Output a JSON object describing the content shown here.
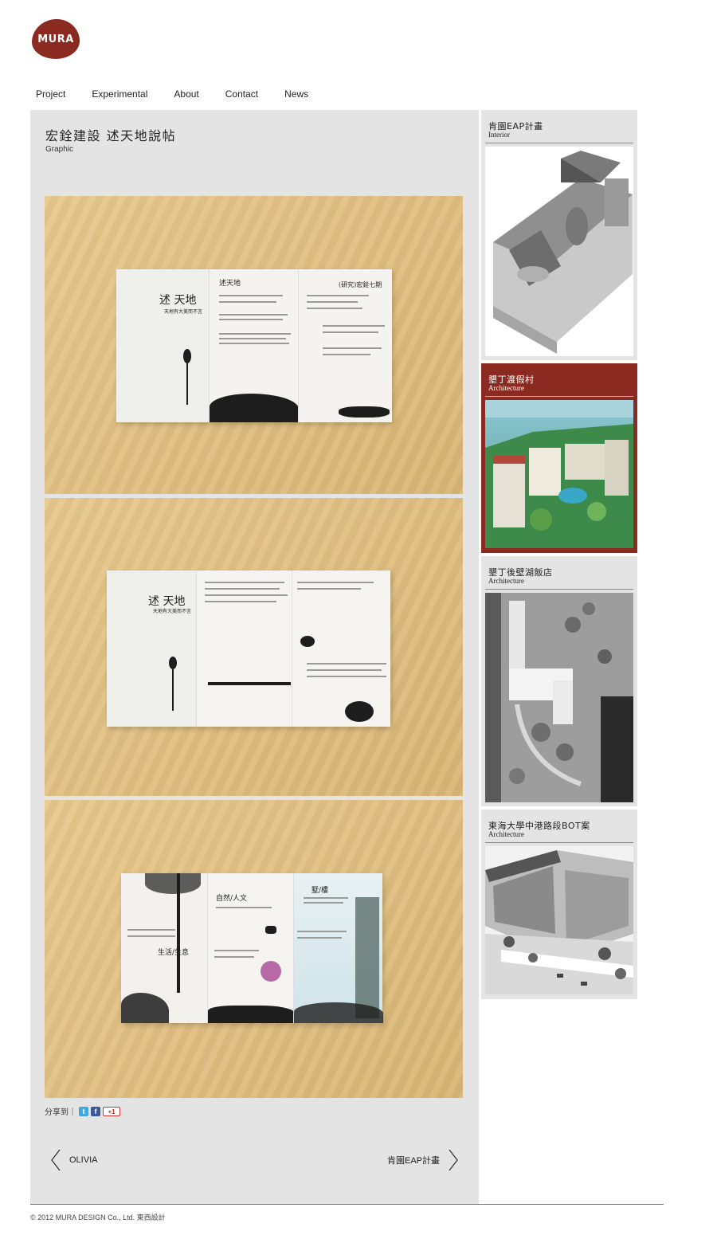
{
  "brand": {
    "logo_text": "MURA",
    "color": "#8a2a20"
  },
  "nav": {
    "items": [
      {
        "label": "Project"
      },
      {
        "label": "Experimental"
      },
      {
        "label": "About"
      },
      {
        "label": "Contact"
      },
      {
        "label": "News"
      }
    ]
  },
  "project": {
    "title": "宏銓建設 述天地說帖",
    "category": "Graphic",
    "photos": [
      {
        "heading": "述 天地",
        "subheading": "天地有大美而不言",
        "panel_title": "述天地",
        "right_title": "(研究)宏銓七期"
      },
      {
        "heading": "述 天地",
        "subheading": "天地有大美而不言"
      },
      {
        "left_heading": "生活/生息",
        "middle_heading": "自然/人文",
        "right_heading": "墅/樓"
      }
    ]
  },
  "share": {
    "label": "分享到｜",
    "icons": [
      "twitter-icon",
      "facebook-icon",
      "google-plus-icon"
    ],
    "gplus_text": "+1"
  },
  "pager": {
    "prev_label": "OLIVIA",
    "next_label": "肯園EAP計畫"
  },
  "sidebar": {
    "cards": [
      {
        "title": "肯園EAP計畫",
        "subtitle": "Interior",
        "active": false,
        "thumb": "interior-model-render"
      },
      {
        "title": "墾丁渡假村",
        "subtitle": "Architecture",
        "active": true,
        "thumb": "resort-aerial-render"
      },
      {
        "title": "墾丁後壁湖飯店",
        "subtitle": "Architecture",
        "active": false,
        "thumb": "hotel-site-plan"
      },
      {
        "title": "東海大學中港路段BOT案",
        "subtitle": "Architecture",
        "active": false,
        "thumb": "campus-building-render"
      }
    ]
  },
  "footer": {
    "copyright": "© 2012 MURA DESIGN Co., Ltd. 東西設計"
  }
}
